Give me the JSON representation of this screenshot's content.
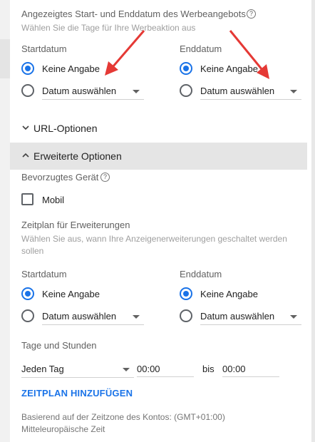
{
  "top_section": {
    "title": "Angezeigtes Start- und Enddatum des Werbeangebots",
    "help_icon": "help-circle-icon",
    "subtitle": "Wählen Sie die Tage für Ihre Werbeaktion aus",
    "start": {
      "label": "Startdatum",
      "option_none": "Keine Angabe",
      "option_pick": "Datum auswählen",
      "selected": "Keine Angabe"
    },
    "end": {
      "label": "Enddatum",
      "option_none": "Keine Angabe",
      "option_pick": "Datum auswählen",
      "selected": "Keine Angabe"
    }
  },
  "url_options": {
    "label": "URL-Optionen",
    "expanded": false,
    "icon": "chevron-down-icon"
  },
  "advanced_options": {
    "label": "Erweiterte Optionen",
    "expanded": true,
    "icon": "chevron-up-icon"
  },
  "device": {
    "label": "Bevorzugtes Gerät",
    "help_icon": "help-circle-icon",
    "option": "Mobil",
    "checked": false
  },
  "schedule": {
    "title": "Zeitplan für Erweiterungen",
    "subtitle": "Wählen Sie aus, wann Ihre Anzeigenerweiterungen geschaltet werden sollen",
    "start": {
      "label": "Startdatum",
      "option_none": "Keine Angabe",
      "option_pick": "Datum auswählen",
      "selected": "Keine Angabe"
    },
    "end": {
      "label": "Enddatum",
      "option_none": "Keine Angabe",
      "option_pick": "Datum auswählen",
      "selected": "Keine Angabe"
    }
  },
  "days_hours": {
    "title": "Tage und Stunden",
    "day_value": "Jeden Tag",
    "from_time": "00:00",
    "to_label": "bis",
    "to_time": "00:00",
    "add_button": "ZEITPLAN HINZUFÜGEN"
  },
  "timezone_note": "Basierend auf der Zeitzone des Kontos: (GMT+01:00) Mitteleuropäische Zeit",
  "annotation_color": "#e53935",
  "accent_color": "#1a73e8"
}
